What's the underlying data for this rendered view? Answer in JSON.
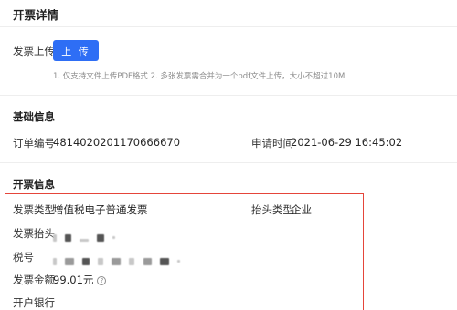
{
  "page": {
    "title": "开票详情"
  },
  "upload": {
    "label": "发票上传",
    "button_label": "上 传",
    "hint": "1. 仅支持文件上传PDF格式 2. 多张发票需合并为一个pdf文件上传，大小不超过10M"
  },
  "basic_info": {
    "title": "基础信息",
    "order_no_label": "订单编号",
    "order_no_value": "4814020201170666670",
    "apply_time_label": "申请时间",
    "apply_time_value": "2021-06-29 16:45:02"
  },
  "invoice_info": {
    "title": "开票信息",
    "invoice_type_label": "发票类型",
    "invoice_type_value": "增值税电子普通发票",
    "header_type_label": "抬头类型",
    "header_type_value": "企业",
    "invoice_header_label": "发票抬头",
    "tax_no_label": "税号",
    "amount_label": "发票金额",
    "amount_value": "99.01元",
    "help_icon_glyph": "?",
    "bank_label": "开户银行"
  },
  "colors": {
    "primary": "#2e6ef5",
    "highlight_border": "#e5453a"
  }
}
